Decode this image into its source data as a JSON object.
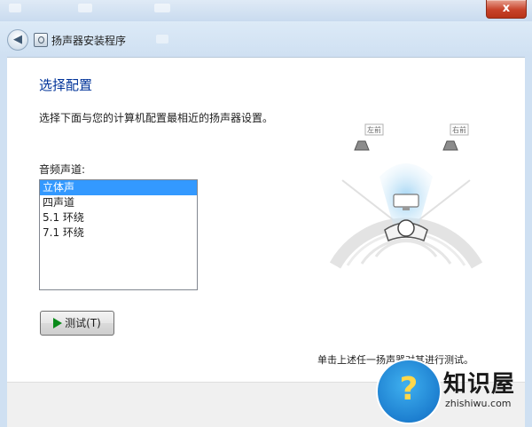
{
  "window": {
    "close_glyph": "x",
    "back_glyph": "◀",
    "title": "扬声器安装程序"
  },
  "page": {
    "heading": "选择配置",
    "description": "选择下面与您的计算机配置最相近的扬声器设置。",
    "channel_label": "音频声道:",
    "channels": [
      {
        "label": "立体声",
        "selected": true
      },
      {
        "label": "四声道",
        "selected": false
      },
      {
        "label": "5.1 环绕",
        "selected": false
      },
      {
        "label": "7.1 环绕",
        "selected": false
      }
    ],
    "test_button": "测试(T)",
    "hint": "单击上述任一扬声器对其进行测试。",
    "speaker_left": "左前",
    "speaker_right": "右前"
  },
  "watermark": {
    "title": "知识屋",
    "url": "zhishiwu.com",
    "badge_glyph": "?"
  },
  "colors": {
    "heading": "#003399",
    "selection": "#3399ff",
    "play": "#0a8a1a",
    "close": "#c8432a"
  }
}
